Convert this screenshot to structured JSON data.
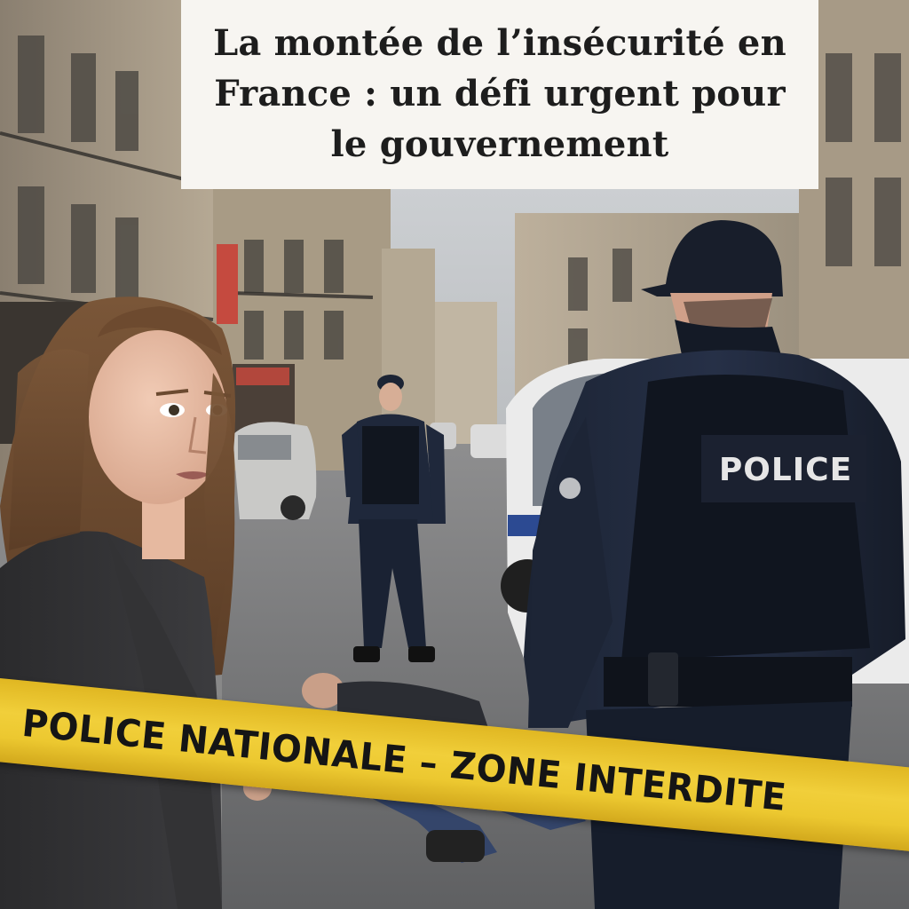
{
  "headline": {
    "text": "La montée de l’insécurité en France : un défi urgent pour le gouvernement",
    "background": "#f7f5f1"
  },
  "tape": {
    "text": "POLICE NATIONALE – ZONE INTERDITE",
    "color": "#f1cf3a"
  },
  "vest_label": "POLICE",
  "scene": {
    "description_icons": [
      "woman",
      "police-officer-foreground",
      "police-officer-background",
      "police-van",
      "person-on-ground",
      "buildings",
      "police-tape"
    ]
  }
}
